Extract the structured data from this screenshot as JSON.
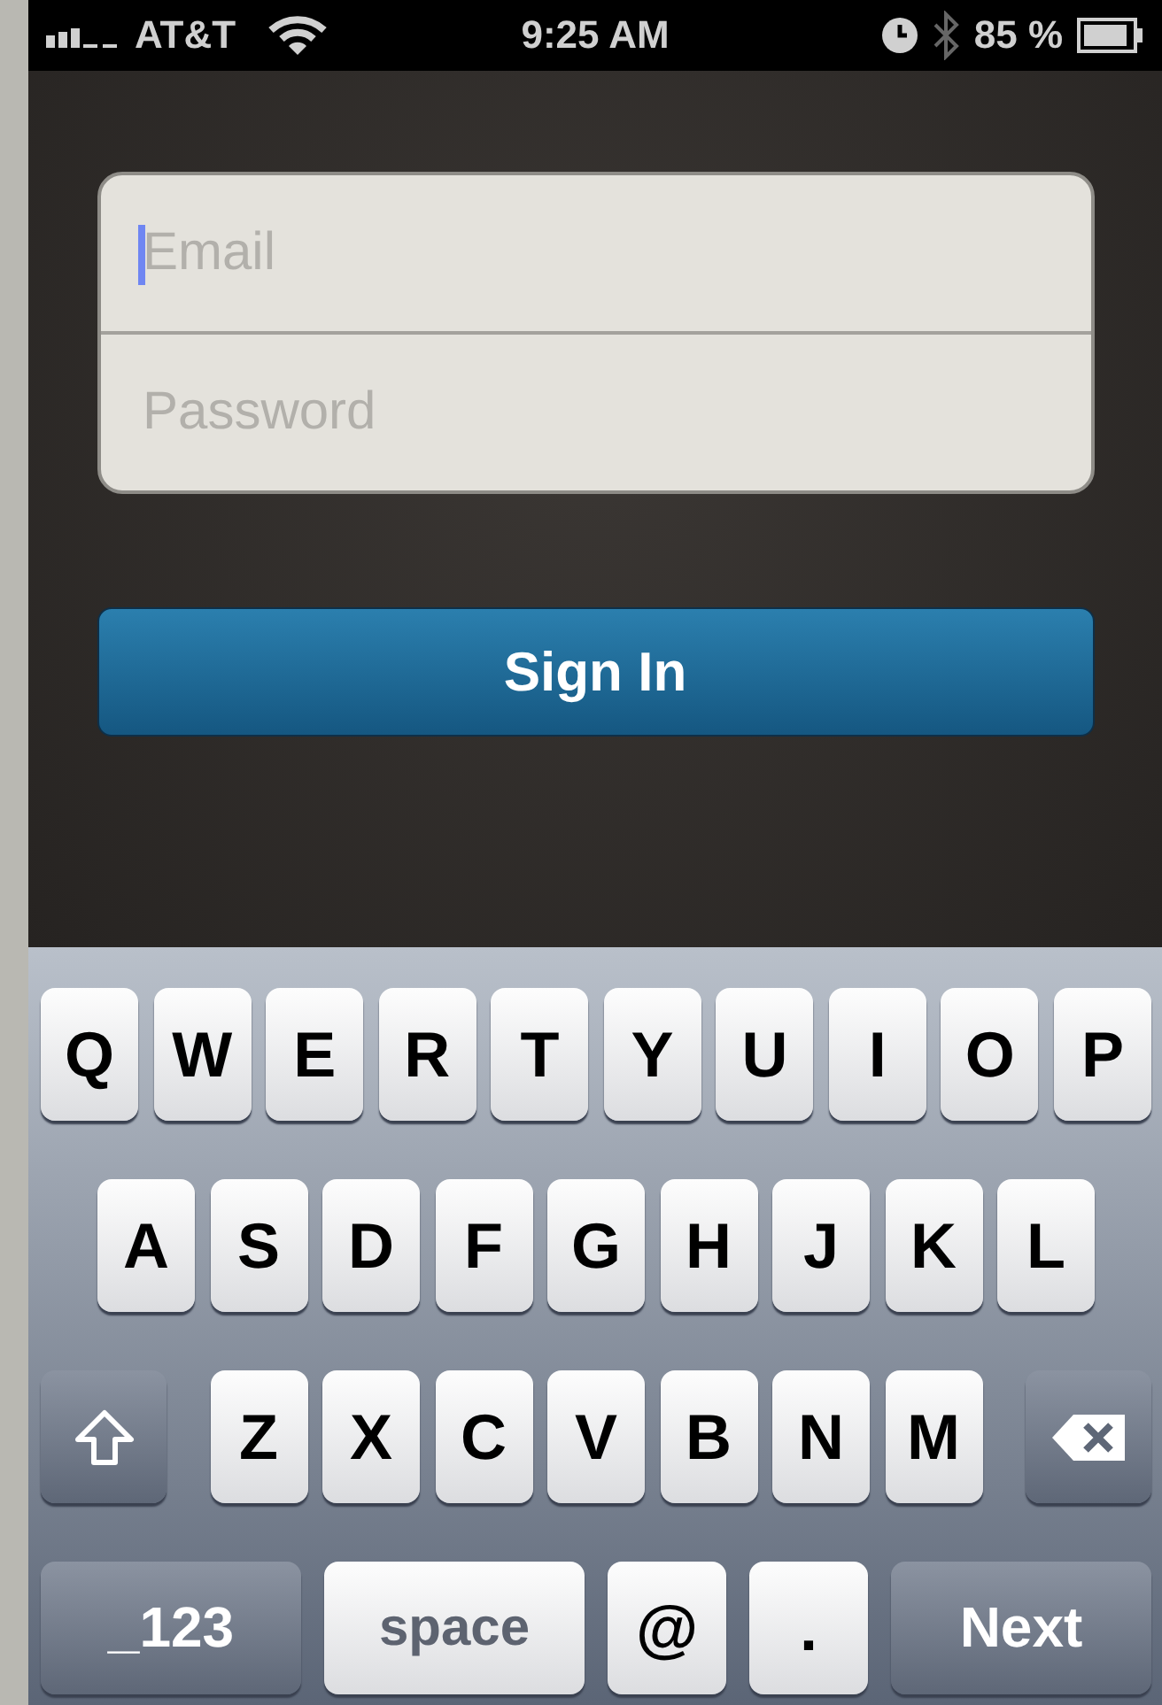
{
  "status_bar": {
    "carrier": "AT&T",
    "time": "9:25 AM",
    "battery": "85 %"
  },
  "login_form": {
    "fields": [
      {
        "placeholder": "Email",
        "focused": true
      },
      {
        "placeholder": "Password",
        "focused": false
      }
    ],
    "button": "Sign In"
  },
  "keyboard": {
    "rows": [
      {
        "keys": [
          {
            "kind": "letter",
            "label": "Q"
          },
          {
            "kind": "letter",
            "label": "W"
          },
          {
            "kind": "letter",
            "label": "E"
          },
          {
            "kind": "letter",
            "label": "R"
          },
          {
            "kind": "letter",
            "label": "T"
          },
          {
            "kind": "letter",
            "label": "Y"
          },
          {
            "kind": "letter",
            "label": "U"
          },
          {
            "kind": "letter",
            "label": "I"
          },
          {
            "kind": "letter",
            "label": "O"
          },
          {
            "kind": "letter",
            "label": "P"
          }
        ]
      },
      {
        "keys": [
          {
            "kind": "letter",
            "label": "A"
          },
          {
            "kind": "letter",
            "label": "S"
          },
          {
            "kind": "letter",
            "label": "D"
          },
          {
            "kind": "letter",
            "label": "F"
          },
          {
            "kind": "letter",
            "label": "G"
          },
          {
            "kind": "letter",
            "label": "H"
          },
          {
            "kind": "letter",
            "label": "J"
          },
          {
            "kind": "letter",
            "label": "K"
          },
          {
            "kind": "letter",
            "label": "L"
          }
        ]
      },
      {
        "keys": [
          {
            "kind": "shift"
          },
          {
            "kind": "letter",
            "label": "Z"
          },
          {
            "kind": "letter",
            "label": "X"
          },
          {
            "kind": "letter",
            "label": "C"
          },
          {
            "kind": "letter",
            "label": "V"
          },
          {
            "kind": "letter",
            "label": "B"
          },
          {
            "kind": "letter",
            "label": "N"
          },
          {
            "kind": "letter",
            "label": "M"
          },
          {
            "kind": "delete"
          }
        ]
      },
      {
        "keys": [
          {
            "kind": "mode",
            "label": "_123"
          },
          {
            "kind": "space",
            "label": "space"
          },
          {
            "kind": "symbol",
            "label": "@"
          },
          {
            "kind": "symbol",
            "label": "."
          },
          {
            "kind": "return",
            "label": "Next"
          }
        ]
      }
    ]
  }
}
